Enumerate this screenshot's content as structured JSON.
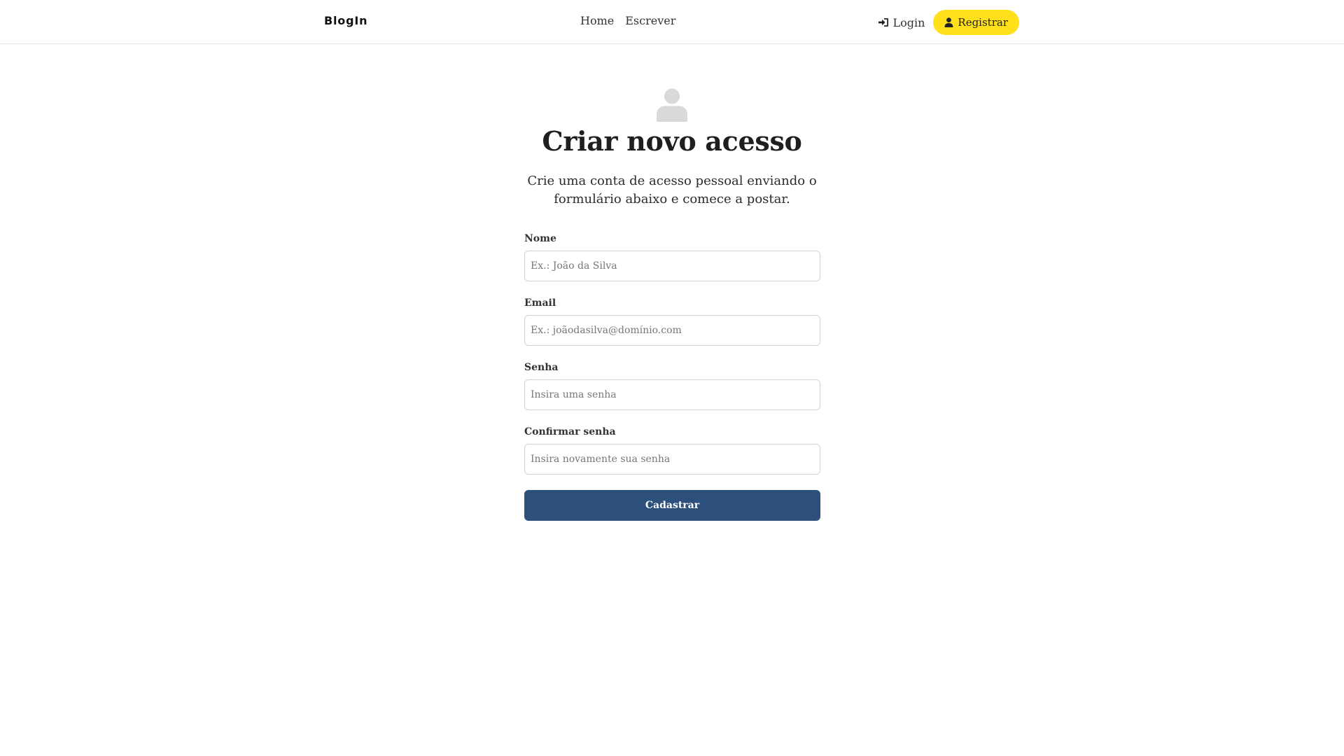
{
  "navbar": {
    "brand": "BlogIn",
    "links": [
      {
        "label": "Home"
      },
      {
        "label": "Escrever"
      }
    ],
    "login_label": "Login",
    "register_label": "Registrar",
    "login_icon": "sign-in-icon",
    "register_icon": "user-icon",
    "register_color": "#ffe01b"
  },
  "page": {
    "icon": "user-avatar-icon",
    "title": "Criar novo acesso",
    "subtitle": "Crie uma conta de acesso pessoal enviando o formulário abaixo e comece a postar."
  },
  "form": {
    "fields": [
      {
        "label": "Nome",
        "value": "",
        "placeholder": "Ex.: João da Silva"
      },
      {
        "label": "Email",
        "value": "",
        "placeholder": "Ex.: joãodasilva@domínio.com"
      },
      {
        "label": "Senha",
        "value": "",
        "placeholder": "Insira uma senha"
      },
      {
        "label": "Confirmar senha",
        "value": "",
        "placeholder": "Insira novamente sua senha"
      }
    ],
    "submit_label": "Cadastrar",
    "submit_color": "#2c4f7c"
  }
}
